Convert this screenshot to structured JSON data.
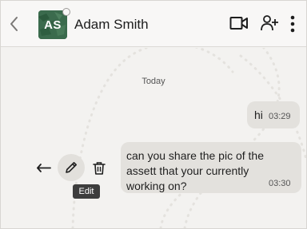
{
  "header": {
    "contact_name": "Adam Smith",
    "avatar_initials": "AS",
    "icons": [
      "back-arrow-icon",
      "video-call-icon",
      "add-person-icon",
      "more-vertical-icon"
    ]
  },
  "chat": {
    "date_label": "Today",
    "messages": [
      {
        "text": "hi",
        "time": "03:29",
        "direction": "outgoing"
      },
      {
        "text": "can you share the pic of the assett that your currently working on?",
        "time": "03:30",
        "direction": "incoming"
      }
    ]
  },
  "message_actions": {
    "icons": [
      "reply-icon",
      "edit-icon",
      "delete-icon"
    ],
    "tooltip": "Edit"
  },
  "colors": {
    "background": "#f3f2f0",
    "bubble": "#e3e1dd",
    "avatar": "#3b6b4d",
    "tooltip": "#3d3d3d"
  }
}
